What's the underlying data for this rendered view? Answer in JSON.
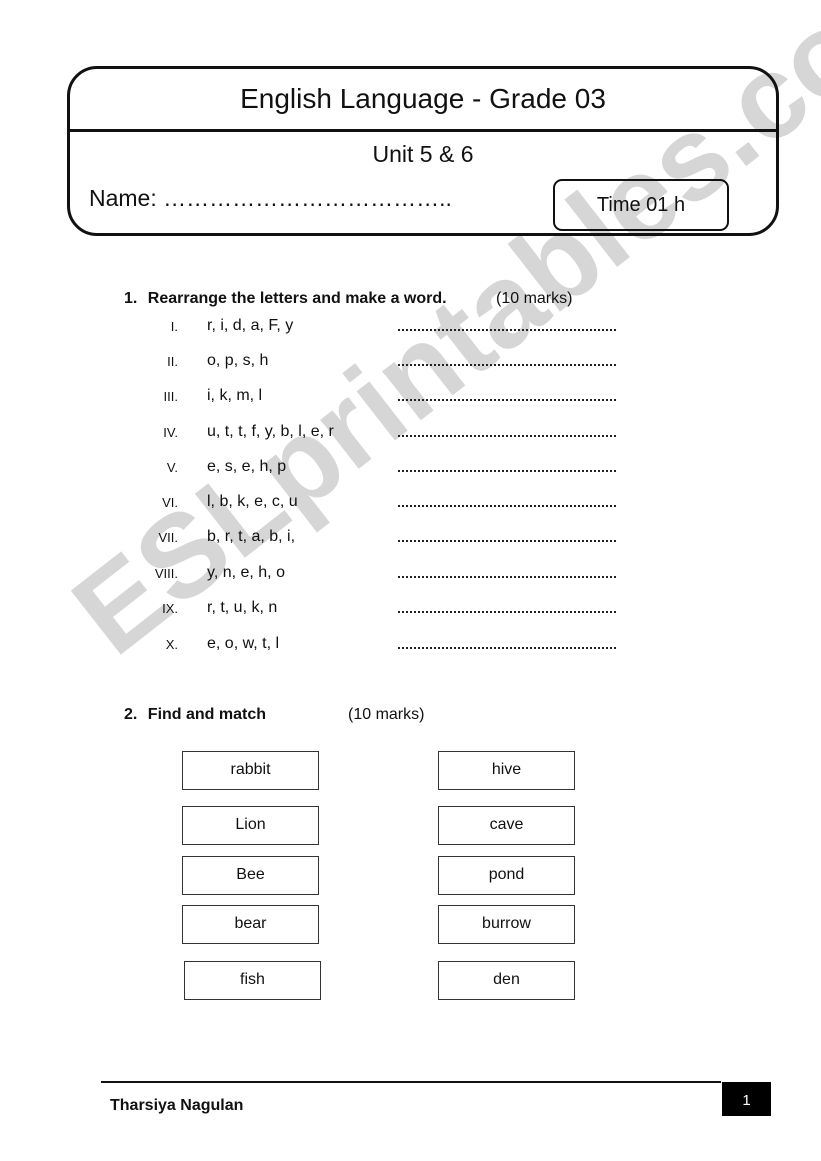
{
  "header": {
    "title": "English Language - Grade 03",
    "unit": "Unit 5 & 6",
    "name_label": "Name: ………………………………..",
    "time": "Time 01 h"
  },
  "watermark": "ESLprintables.com",
  "question1": {
    "number": "1.",
    "title": "Rearrange the letters and make a word.",
    "marks": "(10 marks)",
    "items": [
      {
        "numeral": "I.",
        "letters": "r, i, d, a, F, y"
      },
      {
        "numeral": "II.",
        "letters": "o, p, s, h"
      },
      {
        "numeral": "III.",
        "letters": "i, k, m, l"
      },
      {
        "numeral": "IV.",
        "letters": "u, t, t, f, y, b, l, e, r"
      },
      {
        "numeral": "V.",
        "letters": "e, s, e, h, p"
      },
      {
        "numeral": "VI.",
        "letters": "l, b, k, e, c, u"
      },
      {
        "numeral": "VII.",
        "letters": "b, r, t, a, b, i,"
      },
      {
        "numeral": "VIII.",
        "letters": "y, n, e, h, o"
      },
      {
        "numeral": "IX.",
        "letters": "r, t, u, k, n"
      },
      {
        "numeral": "X.",
        "letters": "e, o, w, t, l"
      }
    ]
  },
  "question2": {
    "number": "2.",
    "title": "Find and match",
    "marks": "(10 marks)",
    "left": [
      "rabbit",
      "Lion",
      "Bee",
      "bear",
      "fish"
    ],
    "right": [
      "hive",
      "cave",
      "pond",
      "burrow",
      "den"
    ]
  },
  "footer": {
    "author": "Tharsiya Nagulan",
    "page": "1"
  }
}
